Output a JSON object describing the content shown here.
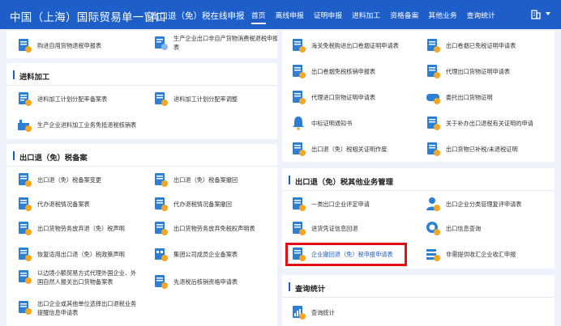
{
  "header": {
    "logo": "中国（上海）国际贸易单一窗口",
    "subtitle": "出口退（免）税在线申报",
    "nav": [
      "首页",
      "离线申报",
      "证明申报",
      "进料加工",
      "资格备案",
      "其他业务",
      "查询统计"
    ],
    "active_nav": "首页",
    "right_icon": "building-icon"
  },
  "left": {
    "top": {
      "items": [
        "购进自用货物退税申报表",
        "生产企业出口非自产货物消费税退税申报表"
      ]
    },
    "jinliao": {
      "title": "进料加工",
      "items": [
        "进料加工计划分配率备案表",
        "进料加工计划分配率调整",
        "生产企业进料加工业务免抵退税核销表"
      ]
    },
    "beian": {
      "title": "出口退（免）税备案",
      "items": [
        "出口退（免）税备案变更",
        "出口退（免）税备案撤回",
        "代办退税情况备案表",
        "代办退税情况备案撤回",
        "出口货物劳务放弃退（免）税声明",
        "出口货物劳务放弃免税权声明表",
        "恢复适用出口退（免）税政策声明",
        "集团公司成员企业备案表",
        "以边境小额贸易方式代理外国企业、外",
        "国自然人报关出口货物备案表",
        "先退税后核销资格申请表",
        "出口企业或其他单位选择出口退税业务",
        "提醒信息申请表"
      ]
    }
  },
  "right": {
    "top": {
      "items": [
        "海关免税购进出口卷烟证明申请表",
        "出口卷烟已免税证明申请表",
        "出口卷烟免税核销申报表",
        "代理出口货物证明申请表",
        "代理进口货物证明申请表",
        "委托出口货物证明",
        "中标证明通知书",
        "关于补办出口退税有关证明的申请",
        "出口退（免）税相关证明作废",
        "出口货物已补税/未退税证明"
      ]
    },
    "other": {
      "title": "出口退（免）税其他业务管理",
      "items": [
        "一类出口企业评定申请",
        "出口企业分类管理复评申请表",
        "进货凭证信息回退",
        "出口信息查询",
        "企业撤回退（免）税申报申请表",
        "非需提供收汇企业收汇申报"
      ]
    },
    "query": {
      "title": "查询统计",
      "items": [
        "查询统计"
      ]
    }
  },
  "colors": {
    "brand": "#1e5ec9",
    "highlight": "#e20f17",
    "icon_blue": "#2d7fd3",
    "icon_orange": "#f5a623"
  }
}
